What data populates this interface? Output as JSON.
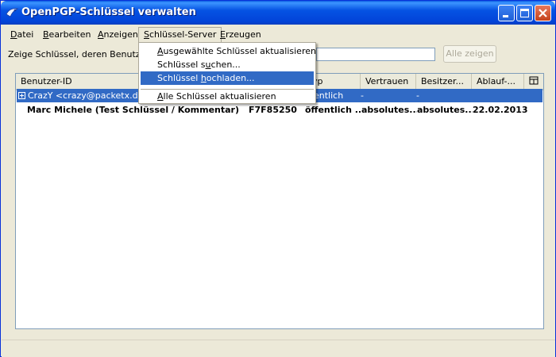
{
  "window": {
    "title": "OpenPGP-Schlüssel verwalten"
  },
  "menubar": {
    "items": [
      {
        "label_u": "D",
        "label_rest": "atei"
      },
      {
        "label_u": "B",
        "label_rest": "earbeiten"
      },
      {
        "label_u": "A",
        "label_rest": "nzeigen"
      },
      {
        "label_u": "S",
        "label_rest": "chlüssel-Server"
      },
      {
        "label_u": "E",
        "label_rest": "rzeugen"
      }
    ]
  },
  "dropdown": {
    "items": [
      {
        "pre": "",
        "u": "A",
        "post": "usgewählte Schlüssel aktualisieren"
      },
      {
        "pre": "Schlüssel s",
        "u": "u",
        "post": "chen..."
      },
      {
        "pre": "Schlüssel ",
        "u": "h",
        "post": "ochladen..."
      },
      {
        "pre": "",
        "u": "A",
        "post": "lle Schlüssel aktualisieren"
      }
    ]
  },
  "search": {
    "label": "Zeige Schlüssel, deren Benutzer-ID",
    "value": "",
    "show_all": "Alle zeigen"
  },
  "table": {
    "columns": [
      "Benutzer-ID",
      "Typ",
      "Vertrauen",
      "Besitzer...",
      "Ablauf-..."
    ],
    "col0_hidden": "Benutzer-ID",
    "col_typ_visible": "yp",
    "rows": [
      {
        "user_id": "CrazY <crazy@packetx.de>",
        "key_id": "",
        "type": "öffentlich",
        "type_visible": "entlich",
        "trust": "-",
        "owner": "-",
        "expiry": ""
      },
      {
        "user_id": "Marc Michele (Test Schlüssel / Kommentar) <...",
        "key_id": "F7F85250",
        "type": "öffentlich ...",
        "trust": "absolutes...",
        "owner": "absolutes...",
        "expiry": "22.02.2013"
      }
    ]
  },
  "colors": {
    "title_blue": "#0553e3",
    "selection": "#316ac5",
    "face": "#ece9d8"
  }
}
